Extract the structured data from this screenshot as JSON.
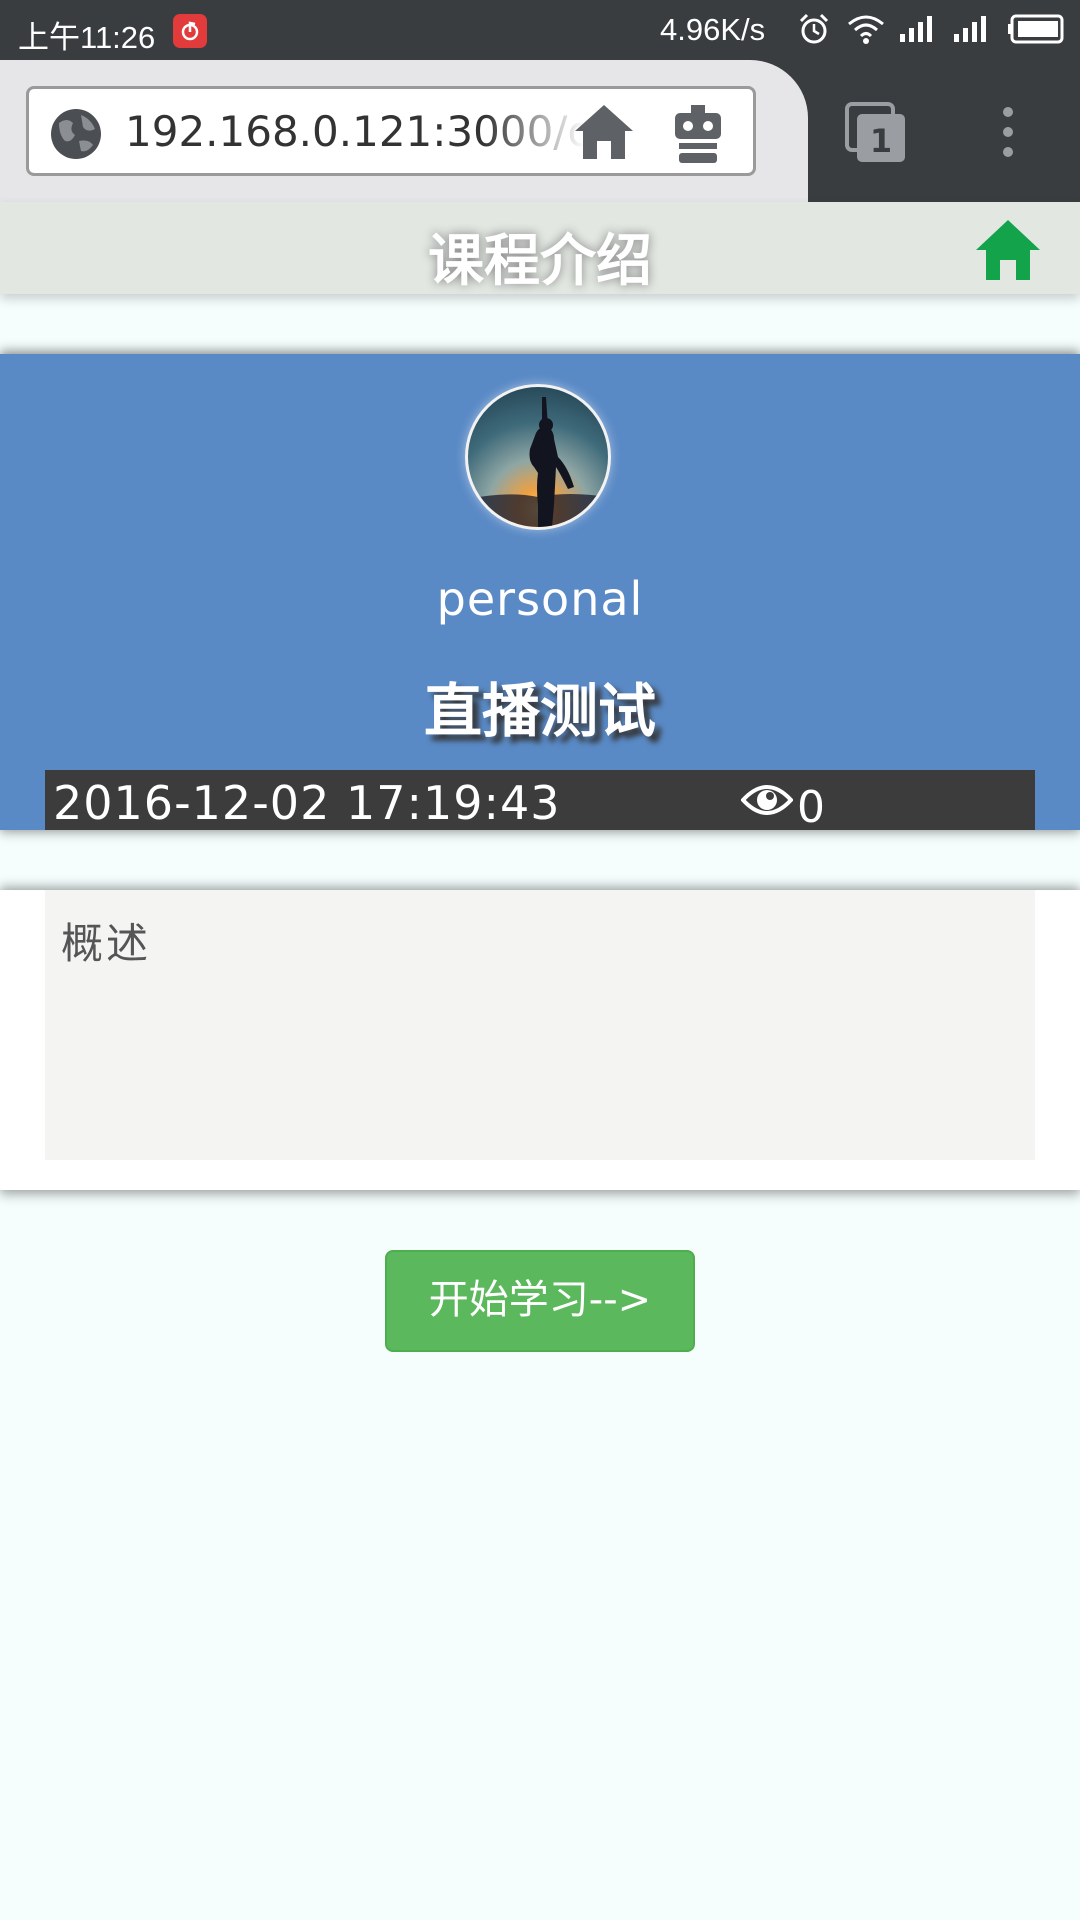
{
  "status_bar": {
    "time": "上午11:26",
    "network_speed": "4.96K/s",
    "icons": [
      "netease-music-icon",
      "alarm-icon",
      "wifi-icon",
      "signal-icon",
      "signal-icon",
      "battery-icon"
    ]
  },
  "browser": {
    "url": "192.168.0.121:3000/c",
    "tab_count": "1",
    "icons": [
      "globe-icon",
      "home-icon",
      "robot-icon",
      "tabs-icon",
      "menu-icon"
    ]
  },
  "header": {
    "title": "课程介绍",
    "home_icon_color": "#13a34a"
  },
  "course": {
    "author": "personal",
    "name": "直播测试",
    "date": "2016-12-02 17:19:43",
    "views": "0",
    "card_color": "#5a8ac6"
  },
  "overview": {
    "title": "概述"
  },
  "start_button": {
    "label": "开始学习-->",
    "color": "#5cb85c"
  }
}
